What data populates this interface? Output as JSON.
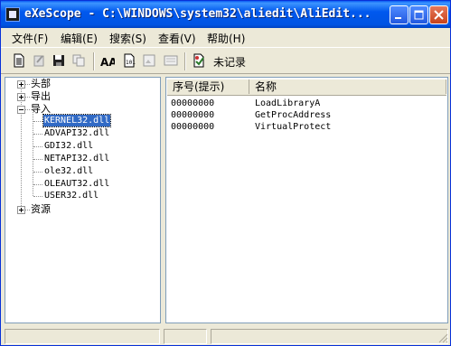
{
  "window": {
    "title": "eXeScope - C:\\WINDOWS\\system32\\aliedit\\AliEdit...",
    "buttons": [
      "minimize",
      "maximize",
      "close"
    ]
  },
  "menu": [
    {
      "label": "文件(F)"
    },
    {
      "label": "编辑(E)"
    },
    {
      "label": "搜索(S)"
    },
    {
      "label": "查看(V)"
    },
    {
      "label": "帮助(H)"
    }
  ],
  "toolbar": {
    "icons": [
      "new-doc-icon",
      "edit-disabled-icon",
      "save-icon",
      "copy-disabled-icon",
      "font-icon",
      "binary-icon",
      "image-disabled-icon",
      "resource-disabled-icon",
      "record-icon"
    ],
    "record_label": "未记录"
  },
  "tree": {
    "header": "头部",
    "export": "导出",
    "import": "导入",
    "imports": [
      "KERNEL32.dll",
      "ADVAPI32.dll",
      "GDI32.dll",
      "NETAPI32.dll",
      "ole32.dll",
      "OLEAUT32.dll",
      "USER32.dll"
    ],
    "selected_import": "KERNEL32.dll",
    "resources": "资源"
  },
  "list": {
    "columns": [
      "序号(提示)",
      "名称"
    ],
    "rows": [
      {
        "ordinal": "00000000",
        "name": "LoadLibraryA"
      },
      {
        "ordinal": "00000000",
        "name": "GetProcAddress"
      },
      {
        "ordinal": "00000000",
        "name": "VirtualProtect"
      }
    ]
  },
  "colors": {
    "titlebar": "#0054E3",
    "selection": "#316AC5",
    "face": "#ECE9D8"
  }
}
